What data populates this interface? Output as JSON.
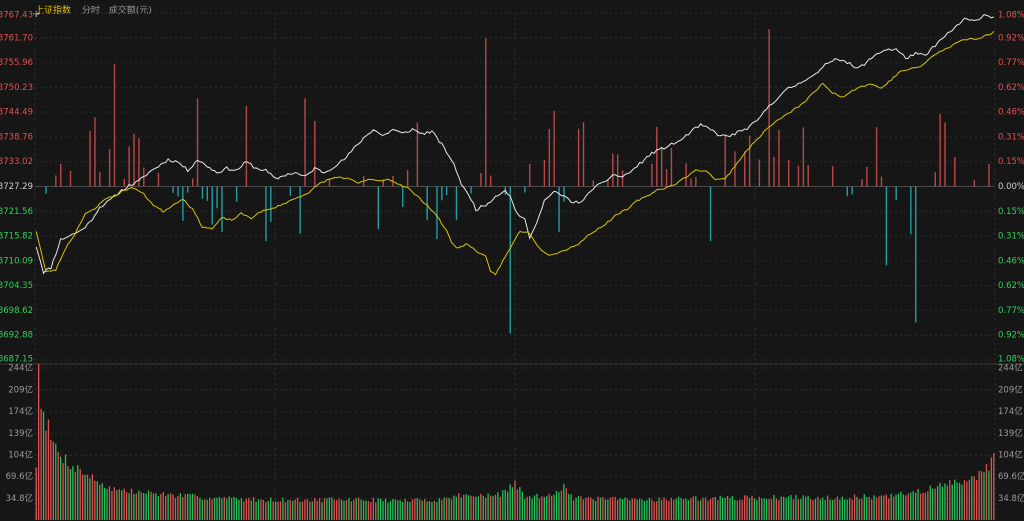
{
  "header": {
    "title": "上证指数",
    "tab_time": "分时",
    "tab_volume": "成交额(元)"
  },
  "colors": {
    "up": "#e05252",
    "down": "#22b2b8",
    "volume_down": "#23c25a",
    "price_line": "#e8e8e8",
    "avg_line": "#d9c400",
    "grid": "#2e2e2e",
    "background": "#161616"
  },
  "chart_data": [
    {
      "type": "line",
      "panel": "price",
      "y_labels_left": [
        "3767.43",
        "3761.70",
        "3755.96",
        "3750.23",
        "3744.49",
        "3738.76",
        "3733.02",
        "3727.29",
        "3721.56",
        "3715.82",
        "3710.09",
        "3704.35",
        "3698.62",
        "3692.88",
        "3687.15"
      ],
      "y_labels_right": [
        "1.08%",
        "0.92%",
        "0.77%",
        "0.62%",
        "0.46%",
        "0.31%",
        "0.15%",
        "0.00%",
        "0.15%",
        "0.31%",
        "0.46%",
        "0.62%",
        "0.77%",
        "0.92%",
        "1.08%"
      ],
      "ylim": [
        3687.15,
        3767.43
      ],
      "baseline": 3727.29,
      "n_points": 241,
      "series": [
        {
          "role": "price",
          "anchors": [
            [
              0,
              3713.5
            ],
            [
              3,
              3707.5
            ],
            [
              6,
              3708.5
            ],
            [
              10,
              3715
            ],
            [
              14,
              3716
            ],
            [
              18,
              3717
            ],
            [
              22,
              3719
            ],
            [
              26,
              3722.5
            ],
            [
              30,
              3724
            ],
            [
              34,
              3726
            ],
            [
              38,
              3727.5
            ],
            [
              42,
              3728.5
            ],
            [
              46,
              3730.5
            ],
            [
              50,
              3732
            ],
            [
              54,
              3733.5
            ],
            [
              58,
              3733
            ],
            [
              62,
              3731
            ],
            [
              66,
              3733.5
            ],
            [
              70,
              3732
            ],
            [
              74,
              3730.5
            ],
            [
              78,
              3731.5
            ],
            [
              82,
              3731
            ],
            [
              86,
              3733
            ],
            [
              90,
              3731.5
            ],
            [
              94,
              3731
            ],
            [
              98,
              3729
            ],
            [
              102,
              3730
            ],
            [
              106,
              3730.5
            ],
            [
              110,
              3729.5
            ],
            [
              114,
              3731.5
            ],
            [
              118,
              3730.5
            ],
            [
              122,
              3732
            ],
            [
              126,
              3733.5
            ],
            [
              130,
              3736
            ],
            [
              134,
              3738.5
            ],
            [
              138,
              3740.5
            ],
            [
              142,
              3739
            ],
            [
              146,
              3740.5
            ],
            [
              150,
              3739.5
            ],
            [
              154,
              3740.5
            ],
            [
              158,
              3739.5
            ],
            [
              162,
              3740
            ],
            [
              166,
              3737
            ],
            [
              170,
              3733.5
            ],
            [
              172,
              3731
            ],
            [
              174,
              3728
            ],
            [
              176,
              3726
            ],
            [
              178,
              3724.5
            ],
            [
              180,
              3722
            ],
            [
              184,
              3723
            ],
            [
              188,
              3725
            ],
            [
              192,
              3726.5
            ],
            [
              194,
              3725
            ],
            [
              196,
              3722
            ],
            [
              198,
              3720.5
            ],
            [
              200,
              3719.5
            ],
            [
              202,
              3715.5
            ],
            [
              204,
              3717.5
            ],
            [
              206,
              3721
            ],
            [
              208,
              3724
            ],
            [
              212,
              3726
            ],
            [
              216,
              3725
            ],
            [
              220,
              3723.5
            ],
            [
              224,
              3724
            ],
            [
              228,
              3727
            ],
            [
              232,
              3728
            ],
            [
              236,
              3730
            ],
            [
              240,
              3729.5
            ],
            [
              244,
              3731
            ],
            [
              248,
              3733
            ],
            [
              252,
              3735
            ],
            [
              256,
              3736
            ],
            [
              260,
              3737
            ],
            [
              264,
              3738
            ],
            [
              268,
              3740
            ],
            [
              272,
              3741.5
            ],
            [
              276,
              3740.5
            ],
            [
              280,
              3739
            ],
            [
              284,
              3739
            ],
            [
              288,
              3740
            ],
            [
              292,
              3741
            ],
            [
              296,
              3743
            ],
            [
              300,
              3746
            ],
            [
              304,
              3748
            ],
            [
              308,
              3750
            ],
            [
              312,
              3751
            ],
            [
              316,
              3752.5
            ],
            [
              320,
              3753.5
            ],
            [
              324,
              3756
            ],
            [
              328,
              3757
            ],
            [
              332,
              3756
            ],
            [
              336,
              3754.5
            ],
            [
              340,
              3756
            ],
            [
              344,
              3758
            ],
            [
              348,
              3759
            ],
            [
              352,
              3759
            ],
            [
              356,
              3757
            ],
            [
              360,
              3758
            ],
            [
              364,
              3757.5
            ],
            [
              368,
              3760
            ],
            [
              372,
              3762
            ],
            [
              376,
              3764
            ],
            [
              380,
              3766
            ],
            [
              384,
              3765.5
            ],
            [
              388,
              3767
            ],
            [
              392,
              3766.5
            ]
          ],
          "x_axis": "minute"
        },
        {
          "role": "average",
          "anchors": [
            [
              0,
              3717
            ],
            [
              4,
              3707.5
            ],
            [
              8,
              3708
            ],
            [
              12,
              3713
            ],
            [
              16,
              3716.5
            ],
            [
              20,
              3721
            ],
            [
              24,
              3722
            ],
            [
              28,
              3724.5
            ],
            [
              32,
              3725
            ],
            [
              36,
              3726.5
            ],
            [
              40,
              3727
            ],
            [
              44,
              3725.5
            ],
            [
              48,
              3723
            ],
            [
              52,
              3721.5
            ],
            [
              56,
              3723
            ],
            [
              60,
              3724.5
            ],
            [
              64,
              3722
            ],
            [
              68,
              3718
            ],
            [
              72,
              3717.5
            ],
            [
              76,
              3720
            ],
            [
              80,
              3719.5
            ],
            [
              84,
              3721
            ],
            [
              88,
              3720
            ],
            [
              92,
              3721.5
            ],
            [
              96,
              3722
            ],
            [
              100,
              3723
            ],
            [
              104,
              3724
            ],
            [
              108,
              3725
            ],
            [
              112,
              3726
            ],
            [
              116,
              3728
            ],
            [
              120,
              3729
            ],
            [
              124,
              3729.5
            ],
            [
              128,
              3729
            ],
            [
              132,
              3728
            ],
            [
              136,
              3729
            ],
            [
              140,
              3728.5
            ],
            [
              144,
              3729
            ],
            [
              148,
              3728
            ],
            [
              152,
              3727
            ],
            [
              156,
              3725
            ],
            [
              160,
              3723
            ],
            [
              164,
              3720.5
            ],
            [
              168,
              3717
            ],
            [
              170,
              3714.5
            ],
            [
              172,
              3713
            ],
            [
              176,
              3714
            ],
            [
              180,
              3712.5
            ],
            [
              184,
              3711
            ],
            [
              186,
              3707.5
            ],
            [
              188,
              3707
            ],
            [
              190,
              3709
            ],
            [
              194,
              3713
            ],
            [
              198,
              3717
            ],
            [
              202,
              3716.5
            ],
            [
              206,
              3713
            ],
            [
              210,
              3711.5
            ],
            [
              214,
              3712
            ],
            [
              218,
              3713
            ],
            [
              222,
              3714
            ],
            [
              226,
              3716
            ],
            [
              230,
              3717.5
            ],
            [
              234,
              3719
            ],
            [
              238,
              3721
            ],
            [
              242,
              3722
            ],
            [
              246,
              3724
            ],
            [
              250,
              3725
            ],
            [
              254,
              3726.5
            ],
            [
              258,
              3727
            ],
            [
              262,
              3728
            ],
            [
              266,
              3729.5
            ],
            [
              270,
              3731
            ],
            [
              274,
              3731
            ],
            [
              278,
              3729
            ],
            [
              282,
              3729
            ],
            [
              286,
              3732
            ],
            [
              290,
              3735
            ],
            [
              294,
              3737.5
            ],
            [
              298,
              3740
            ],
            [
              302,
              3742
            ],
            [
              306,
              3743.5
            ],
            [
              310,
              3745
            ],
            [
              314,
              3746.5
            ],
            [
              318,
              3749
            ],
            [
              322,
              3751
            ],
            [
              326,
              3749
            ],
            [
              330,
              3748
            ],
            [
              334,
              3749.5
            ],
            [
              338,
              3750.5
            ],
            [
              342,
              3751
            ],
            [
              346,
              3750
            ],
            [
              350,
              3752
            ],
            [
              354,
              3754
            ],
            [
              358,
              3754.5
            ],
            [
              362,
              3755
            ],
            [
              366,
              3757
            ],
            [
              370,
              3758.5
            ],
            [
              374,
              3759.5
            ],
            [
              378,
              3761
            ],
            [
              382,
              3761.5
            ],
            [
              386,
              3761.5
            ],
            [
              390,
              3762.5
            ],
            [
              392,
              3763
            ]
          ],
          "x_axis": "minute"
        }
      ],
      "flow_bars_seed": 20240527
    },
    {
      "type": "bar",
      "panel": "volume",
      "y_labels_left": [
        "244亿",
        "209亿",
        "174亿",
        "139亿",
        "104亿",
        "69.6亿",
        "34.8亿"
      ],
      "y_labels_right": [
        "244亿",
        "209亿",
        "174亿",
        "139亿",
        "104亿",
        "69.6亿",
        "34.8亿"
      ],
      "ylim": [
        0,
        244
      ],
      "unit": "亿",
      "profile": [
        [
          0,
          90
        ],
        [
          1,
          244
        ],
        [
          2,
          200
        ],
        [
          3,
          180
        ],
        [
          4,
          160
        ],
        [
          5,
          145
        ],
        [
          6,
          130
        ],
        [
          8,
          115
        ],
        [
          10,
          105
        ],
        [
          14,
          90
        ],
        [
          18,
          80
        ],
        [
          22,
          70
        ],
        [
          26,
          60
        ],
        [
          30,
          52
        ],
        [
          34,
          48
        ],
        [
          40,
          45
        ],
        [
          48,
          43
        ],
        [
          56,
          40
        ],
        [
          70,
          36
        ],
        [
          90,
          33
        ],
        [
          110,
          32
        ],
        [
          130,
          33
        ],
        [
          150,
          31
        ],
        [
          166,
          33
        ],
        [
          172,
          38
        ],
        [
          176,
          44
        ],
        [
          178,
          38
        ],
        [
          190,
          40
        ],
        [
          196,
          60
        ],
        [
          200,
          36
        ],
        [
          210,
          40
        ],
        [
          216,
          55
        ],
        [
          220,
          35
        ],
        [
          240,
          33
        ],
        [
          260,
          34
        ],
        [
          280,
          35
        ],
        [
          300,
          36
        ],
        [
          320,
          36
        ],
        [
          340,
          37
        ],
        [
          350,
          38
        ],
        [
          356,
          42
        ],
        [
          360,
          46
        ],
        [
          366,
          50
        ],
        [
          372,
          56
        ],
        [
          378,
          62
        ],
        [
          384,
          70
        ],
        [
          388,
          80
        ],
        [
          390,
          90
        ],
        [
          392,
          102
        ]
      ],
      "colors_seed": 7
    }
  ]
}
